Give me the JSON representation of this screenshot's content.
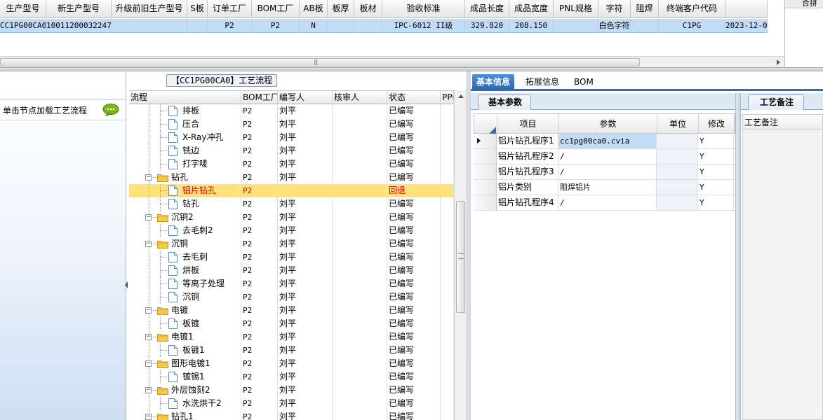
{
  "top_grid": {
    "headers": [
      "生产型号",
      "新生产型号",
      "升级前旧生产型号",
      "S板",
      "订单工厂",
      "BOM工厂",
      "AB板",
      "板厚",
      "板材",
      "验收标准",
      "成品长度",
      "成品宽度",
      "PNL规格",
      "字符",
      "阻焊",
      "终端客户代码",
      ""
    ],
    "row": [
      "CC1PG00CA0",
      "10011200032247",
      "",
      "",
      "P2",
      "P2",
      "N",
      "",
      "",
      "IPC-6012 II级",
      "329.820",
      "208.150",
      "",
      "白色字符",
      "",
      "C1PG",
      "2023-12-0"
    ]
  },
  "right_top_panel": {
    "header": "合拼"
  },
  "left_panel": {
    "hint": "单击节点加载工艺流程"
  },
  "middle_panel": {
    "title": "【CC1PG00CA0】工艺流程",
    "headers": [
      "流程",
      "BOM工厂",
      "编写人",
      "核审人",
      "状态",
      "PPC"
    ],
    "rows": [
      {
        "name": "排板",
        "level": 2,
        "type": "doc",
        "bom": "P2",
        "writer": "刘平",
        "reviewer": "",
        "status": "已编写"
      },
      {
        "name": "压合",
        "level": 2,
        "type": "doc",
        "bom": "P2",
        "writer": "刘平",
        "reviewer": "",
        "status": "已编写"
      },
      {
        "name": "X-Ray冲孔",
        "level": 2,
        "type": "doc",
        "bom": "P2",
        "writer": "刘平",
        "reviewer": "",
        "status": "已编写"
      },
      {
        "name": "铣边",
        "level": 2,
        "type": "doc",
        "bom": "P2",
        "writer": "刘平",
        "reviewer": "",
        "status": "已编写"
      },
      {
        "name": "打字唛",
        "level": 2,
        "type": "doc",
        "bom": "P2",
        "writer": "刘平",
        "reviewer": "",
        "status": "已编写"
      },
      {
        "name": "钻孔",
        "level": 1,
        "type": "folder",
        "bom": "P2",
        "writer": "刘平",
        "reviewer": "",
        "status": "已编写"
      },
      {
        "name": "铝片钻孔",
        "level": 2,
        "type": "doc",
        "bom": "P2",
        "writer": "",
        "reviewer": "",
        "status": "回退",
        "selected": true
      },
      {
        "name": "钻孔",
        "level": 2,
        "type": "doc",
        "bom": "P2",
        "writer": "刘平",
        "reviewer": "",
        "status": "已编写"
      },
      {
        "name": "沉铜2",
        "level": 1,
        "type": "folder",
        "bom": "P2",
        "writer": "刘平",
        "reviewer": "",
        "status": "已编写"
      },
      {
        "name": "去毛刺2",
        "level": 2,
        "type": "doc",
        "bom": "P2",
        "writer": "刘平",
        "reviewer": "",
        "status": "已编写"
      },
      {
        "name": "沉铜",
        "level": 1,
        "type": "folder",
        "bom": "P2",
        "writer": "刘平",
        "reviewer": "",
        "status": "已编写"
      },
      {
        "name": "去毛刺",
        "level": 2,
        "type": "doc",
        "bom": "P2",
        "writer": "刘平",
        "reviewer": "",
        "status": "已编写"
      },
      {
        "name": "烘板",
        "level": 2,
        "type": "doc",
        "bom": "P2",
        "writer": "刘平",
        "reviewer": "",
        "status": "已编写"
      },
      {
        "name": "等离子处理",
        "level": 2,
        "type": "doc",
        "bom": "P2",
        "writer": "刘平",
        "reviewer": "",
        "status": "已编写"
      },
      {
        "name": "沉铜",
        "level": 2,
        "type": "doc",
        "bom": "P2",
        "writer": "刘平",
        "reviewer": "",
        "status": "已编写"
      },
      {
        "name": "电镀",
        "level": 1,
        "type": "folder",
        "bom": "P2",
        "writer": "刘平",
        "reviewer": "",
        "status": "已编写"
      },
      {
        "name": "板镀",
        "level": 2,
        "type": "doc",
        "bom": "P2",
        "writer": "刘平",
        "reviewer": "",
        "status": "已编写"
      },
      {
        "name": "电镀1",
        "level": 1,
        "type": "folder",
        "bom": "P2",
        "writer": "刘平",
        "reviewer": "",
        "status": "已编写"
      },
      {
        "name": "板镀1",
        "level": 2,
        "type": "doc",
        "bom": "P2",
        "writer": "刘平",
        "reviewer": "",
        "status": "已编写"
      },
      {
        "name": "图形电镀1",
        "level": 1,
        "type": "folder",
        "bom": "P2",
        "writer": "刘平",
        "reviewer": "",
        "status": "已编写"
      },
      {
        "name": "镀锡1",
        "level": 2,
        "type": "doc",
        "bom": "P2",
        "writer": "刘平",
        "reviewer": "",
        "status": "已编写"
      },
      {
        "name": "外层蚀刻2",
        "level": 1,
        "type": "folder",
        "bom": "P2",
        "writer": "刘平",
        "reviewer": "",
        "status": "已编写"
      },
      {
        "name": "水洗烘干2",
        "level": 2,
        "type": "doc",
        "bom": "P2",
        "writer": "刘平",
        "reviewer": "",
        "status": "已编写"
      },
      {
        "name": "钻孔1",
        "level": 1,
        "type": "folder",
        "bom": "P2",
        "writer": "刘平",
        "reviewer": "",
        "status": "已编写"
      }
    ]
  },
  "right_panel": {
    "tabs": [
      "基本信息",
      "拓展信息",
      "BOM"
    ],
    "active_tab": "基本信息",
    "sub_tab": "基本参数",
    "param_headers": [
      "项目",
      "参数",
      "单位",
      "修改"
    ],
    "params": [
      {
        "item": "铝片钻孔程序1",
        "value": "cc1pg00ca0.cvia",
        "unit": "",
        "modify": "Y",
        "current": true
      },
      {
        "item": "铝片钻孔程序2",
        "value": "/",
        "unit": "",
        "modify": "Y"
      },
      {
        "item": "铝片钻孔程序3",
        "value": "/",
        "unit": "",
        "modify": "Y"
      },
      {
        "item": "铝片类别",
        "value": "阻焊铝片",
        "unit": "",
        "modify": "Y"
      },
      {
        "item": "铝片钻孔程序4",
        "value": "/",
        "unit": "",
        "modify": "Y"
      }
    ],
    "remarks_tab": "工艺备注",
    "remarks_header": "工艺备注"
  },
  "colors": {
    "selection": "#c3dcf5",
    "tree_selected": "#ffe27a",
    "accent": "#2f6eb5",
    "rollback": "#d40000"
  }
}
